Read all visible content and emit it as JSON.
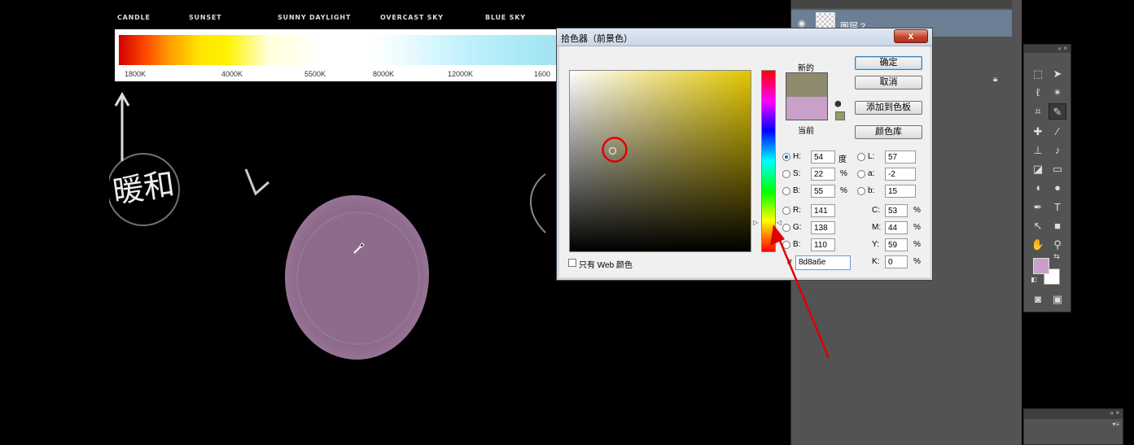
{
  "canvas": {
    "temperature_labels": [
      "CANDLE",
      "SUNSET",
      "SUNNY DAYLIGHT",
      "OVERCAST SKY",
      "BLUE SKY"
    ],
    "temperature_ticks": [
      "1800K",
      "4000K",
      "5500K",
      "8000K",
      "12000K",
      "1600"
    ],
    "handwritten_text": "暖和",
    "paint_color": "#8d6b8b"
  },
  "dialog": {
    "title": "拾色器（前景色）",
    "close_label": "x",
    "new_label": "新的",
    "current_label": "当前",
    "new_color": "#8d8a6e",
    "current_color": "#c8a0c8",
    "buttons": {
      "ok": "确定",
      "cancel": "取消",
      "add_swatch": "添加到色板",
      "color_library": "颜色库"
    },
    "hsb": {
      "h_label": "H:",
      "h_value": "54",
      "h_unit": "度",
      "s_label": "S:",
      "s_value": "22",
      "s_unit": "%",
      "b_label": "B:",
      "b_value": "55",
      "b_unit": "%"
    },
    "lab": {
      "l_label": "L:",
      "l_value": "57",
      "a_label": "a:",
      "a_value": "-2",
      "b_label": "b:",
      "b_value": "15"
    },
    "rgb": {
      "r_label": "R:",
      "r_value": "141",
      "g_label": "G:",
      "g_value": "138",
      "b_label": "B:",
      "b_value": "110"
    },
    "cmyk": {
      "c_label": "C:",
      "c_value": "53",
      "m_label": "M:",
      "m_value": "44",
      "y_label": "Y:",
      "y_value": "59",
      "k_label": "K:",
      "k_value": "0",
      "unit": "%"
    },
    "hex_label": "#",
    "hex_value": "8d8a6e",
    "web_only_label": "只有 Web 颜色"
  },
  "layers": {
    "layer_name": "图层 2"
  },
  "tools": {
    "foreground_color": "#c8a0c8",
    "background_color": "#ffffff"
  },
  "annotation": {
    "circle_color": "#e00000",
    "arrow_color": "#e00000"
  }
}
